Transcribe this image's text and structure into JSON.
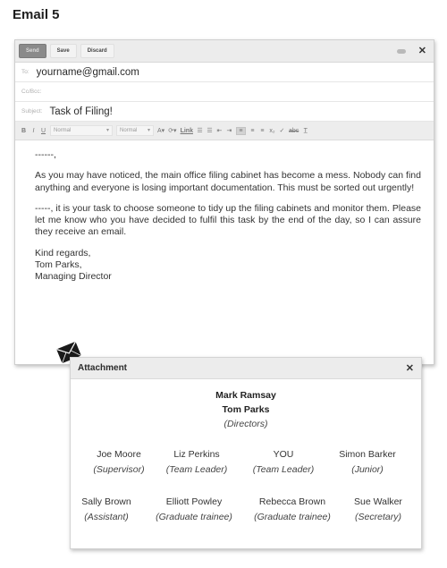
{
  "page": {
    "title": "Email 5"
  },
  "email": {
    "toolbar": {
      "send": "Send",
      "save": "Save",
      "discard": "Discard"
    },
    "to": {
      "label": "To:",
      "value": "yourname@gmail.com"
    },
    "cc": {
      "label": "Cc/Bcc:",
      "value": ""
    },
    "subject": {
      "label": "Subject:",
      "value": "Task of Filing!"
    },
    "format_bar": {
      "font_family": "Normal",
      "font_size": "Normal",
      "link": "Link"
    },
    "body": {
      "greeting": "------,",
      "paragraph1": "As you may have noticed, the main office filing cabinet has become a mess. Nobody can find anything and everyone is losing important documentation. This must be sorted out urgently!",
      "paragraph2": "-----, it is your task to choose someone to tidy up the filing cabinets and monitor them. Please let me know who you have decided to fulfil this task by the end of the day, so I can assure they receive an email.",
      "signoff": "Kind regards,",
      "sender_name": "Tom Parks,",
      "sender_title": "Managing Director"
    }
  },
  "attachment": {
    "title": "Attachment",
    "directors": {
      "names": [
        "Mark Ramsay",
        "Tom Parks"
      ],
      "role": "(Directors)"
    },
    "row1": [
      {
        "name": "Joe Moore",
        "role": "(Supervisor)"
      },
      {
        "name": "Liz Perkins",
        "role": "(Team Leader)"
      },
      {
        "name": "YOU",
        "role": "(Team Leader)"
      },
      {
        "name": "Simon Barker",
        "role": "(Junior)"
      }
    ],
    "row2": [
      {
        "name": "Sally Brown",
        "role": "(Assistant)"
      },
      {
        "name": "Elliott Powley",
        "role": "(Graduate trainee)"
      },
      {
        "name": "Rebecca Brown",
        "role": "(Graduate trainee)"
      },
      {
        "name": "Sue Walker",
        "role": "(Secretary)"
      }
    ]
  }
}
